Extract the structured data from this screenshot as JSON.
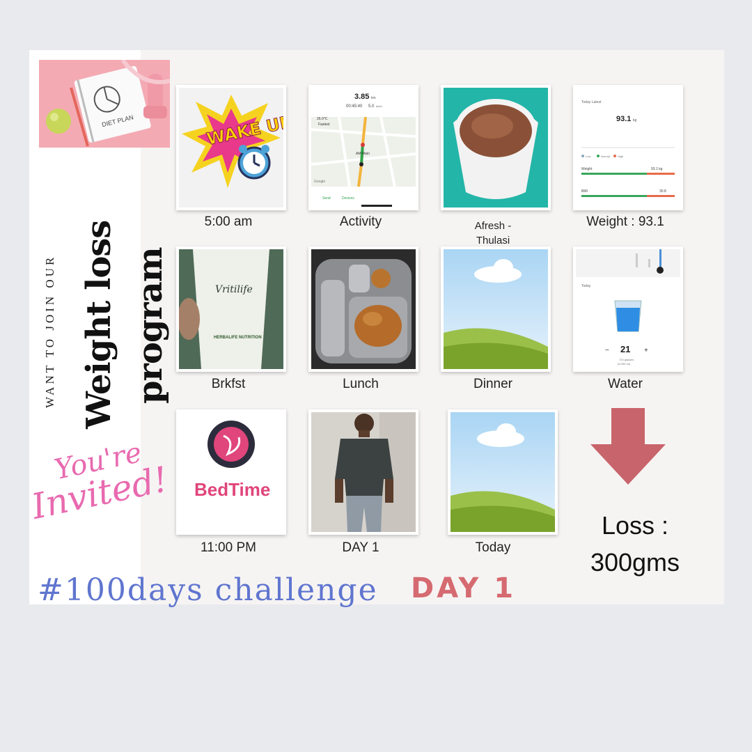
{
  "side": {
    "want": "WANT TO JOIN OUR",
    "title_line1": "Weight loss",
    "title_line2": "program",
    "invite_line1": "You're",
    "invite_line2": "Invited!",
    "diet_note": "DIET PLAN"
  },
  "tiles": [
    {
      "caption": "5:00 am",
      "image": "wake-up-alarm-image",
      "text": "WAKE UP!"
    },
    {
      "caption": "Activity",
      "image": "map-activity-screenshot",
      "distance": "3.85",
      "distance_unit": "km",
      "time": "00:45:40",
      "speed": "5.0",
      "speed_unit": "km/h",
      "map_label": "AM Main",
      "map_top_label": "Fastest",
      "temperature": "26.0°C",
      "google": "Google",
      "share": "Send",
      "details": "Devices"
    },
    {
      "caption_line1": "Afresh -",
      "caption_line2": "Thulasi",
      "image": "tea-cup-image"
    },
    {
      "caption": "Weight : 93.1",
      "image": "weight-app-screenshot",
      "latest": "Today Latest",
      "value": "93.1",
      "unit": "kg",
      "legend": [
        "Low",
        "Normal",
        "High"
      ],
      "weight_label": "Weight",
      "weight_value": "93.1 kg",
      "bmi_label": "BMI",
      "bmi_value": "30.8"
    },
    {
      "caption": "Brkfst",
      "image": "vritilife-drink-image",
      "brand": "Vritilife",
      "sub": "HERBALIFE NUTRITION"
    },
    {
      "caption": "Lunch",
      "image": "lunch-plate-image"
    },
    {
      "caption": "Dinner",
      "image": "dinner-placeholder-image"
    },
    {
      "caption": "Water",
      "image": "water-tracker-screenshot",
      "today": "Today",
      "count": "21",
      "detail_line1": "720 glasses",
      "detail_line2": "(5,250 ml)"
    },
    {
      "caption": "11:00 PM",
      "image": "bedtime-image",
      "text": "BedTime"
    },
    {
      "caption": "DAY 1",
      "image": "man-standing-photo"
    },
    {
      "caption": "Today",
      "image": "today-placeholder-image"
    }
  ],
  "loss": {
    "line1": "Loss :",
    "line2": "300gms"
  },
  "footer": {
    "tag": "#100days challenge",
    "day": "DAY 1"
  },
  "colors": {
    "background": "#e9eaee",
    "card": "#f6f4f3",
    "arrow": "#c8646b",
    "tag": "#5f75cf",
    "day": "#d56a70",
    "invite": "#e86aaf"
  }
}
